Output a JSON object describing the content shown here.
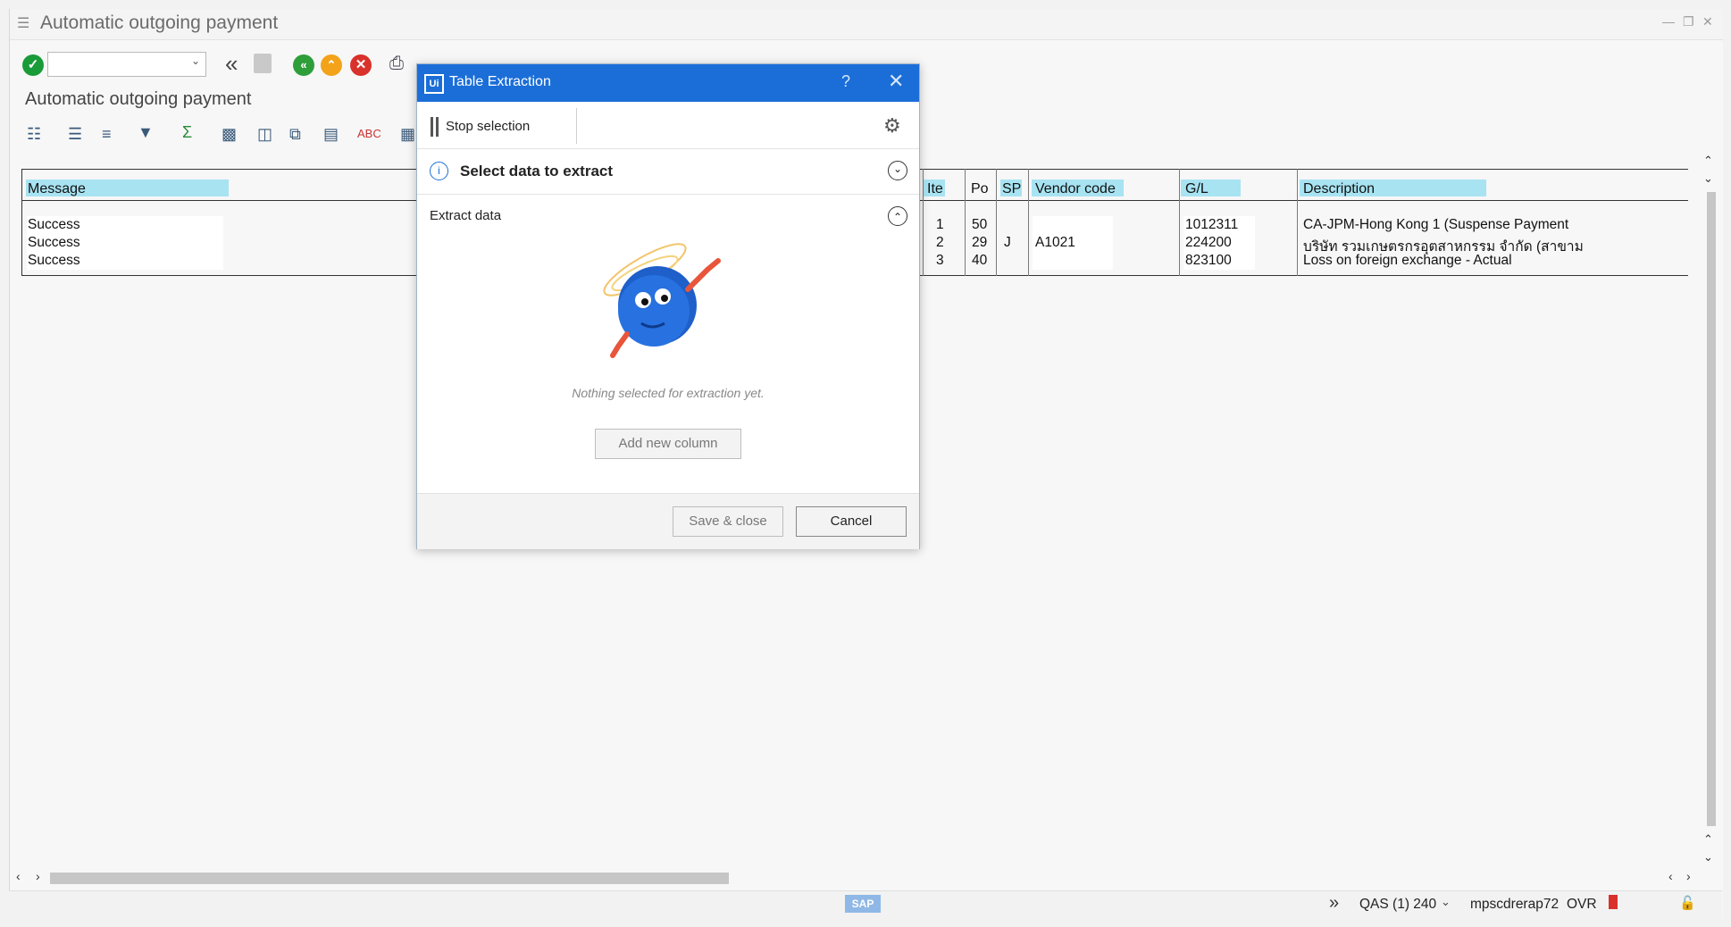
{
  "window": {
    "title": "Automatic outgoing payment"
  },
  "screen": {
    "subtitle": "Automatic outgoing payment"
  },
  "table": {
    "headers": {
      "message": "Message",
      "item": "Ite",
      "po": "Po",
      "sp": "SP",
      "vendor": "Vendor code",
      "gl": "G/L",
      "description": "Description"
    },
    "rows": [
      {
        "message": "Success",
        "item": "1",
        "po": "50",
        "sp": "",
        "vendor": "",
        "gl": "1012311",
        "description": "CA-JPM-Hong Kong 1 (Suspense Payment"
      },
      {
        "message": "Success",
        "item": "2",
        "po": "29",
        "sp": "J",
        "vendor": "A1021",
        "gl": "224200",
        "description": "บริษัท รวมเกษตรกรอุตสาหกรรม จำกัด (สาขาม"
      },
      {
        "message": "Success",
        "item": "3",
        "po": "40",
        "sp": "",
        "vendor": "",
        "gl": "823100",
        "description": "Loss on foreign exchange - Actual"
      }
    ]
  },
  "dialog": {
    "title": "Table Extraction",
    "logo": "Ui",
    "help": "?",
    "stop_selection": "Stop selection",
    "select_section": "Select data to extract",
    "extract_section": "Extract data",
    "empty_message": "Nothing selected for extraction yet.",
    "add_column": "Add new column",
    "save_close": "Save & close",
    "cancel": "Cancel"
  },
  "status": {
    "system": "QAS (1) 240",
    "server": "mpscdrerap72",
    "mode": "OVR"
  },
  "colors": {
    "dialog_header": "#1b6ed8",
    "header_highlight": "#a8e3f2",
    "ok_green": "#1a9b3a",
    "back_green": "#2e9e3a",
    "exit_orange": "#f2a31a",
    "cancel_red": "#d9312b"
  }
}
